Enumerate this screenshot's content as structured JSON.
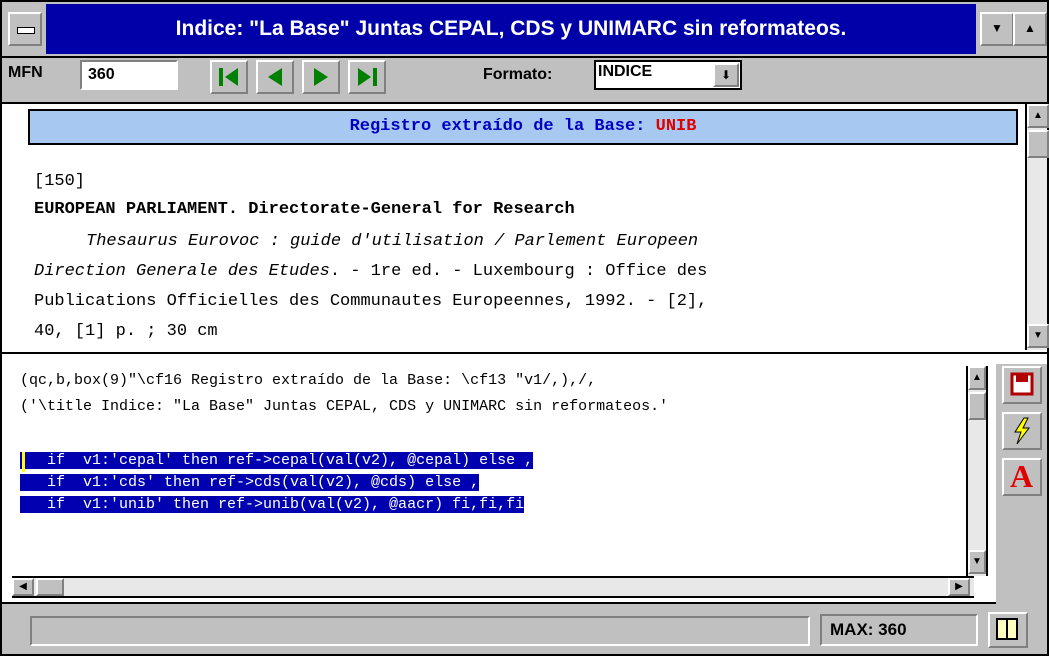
{
  "window": {
    "title": "Indice: \"La Base\"  Juntas CEPAL, CDS y UNIMARC sin reformateos."
  },
  "toolbar": {
    "mfn_label": "MFN",
    "mfn_value": "360",
    "nav": [
      "first-record",
      "previous-record",
      "next-record",
      "last-record"
    ],
    "formato_label": "Formato:",
    "formato_value": "INDICE"
  },
  "record": {
    "header_prefix": "Registro extraído de la Base: ",
    "header_base": "UNIB",
    "number": "[150]",
    "author": "EUROPEAN PARLIAMENT. Directorate-General for Research",
    "title_line1_italic": "Thesaurus Eurovoc : guide d'utilisation / Parlement Europeen",
    "line2_italic": "Direction Generale des Etudes",
    "line2_rest": ". - 1re ed. - Luxembourg : Office des",
    "line3": "Publications Officielles des Communautes Europeennes, 1992. - [2],",
    "line4": "40, [1] p. ; 30 cm"
  },
  "format_code": {
    "line1": "(qc,b,box(9)\"\\cf16 Registro extraído de la Base: \\cf13 \"v1/,),/,",
    "line2": "('\\title Indice:  \"La  Base\"   Juntas CEPAL, CDS y UNIMARC sin reformateos.'",
    "selected_lines": [
      "   if  v1:'cepal' then ref->cepal(val(v2), @cepal) else ,",
      "   if  v1:'cds' then ref->cds(val(v2), @cds) else ,",
      "   if  v1:'unib' then ref->unib(val(v2), @aacr) fi,fi,fi"
    ]
  },
  "side_buttons": [
    "save-icon",
    "lightning-icon",
    "font-icon"
  ],
  "status": {
    "message": "",
    "max_label": "MAX: 360"
  }
}
